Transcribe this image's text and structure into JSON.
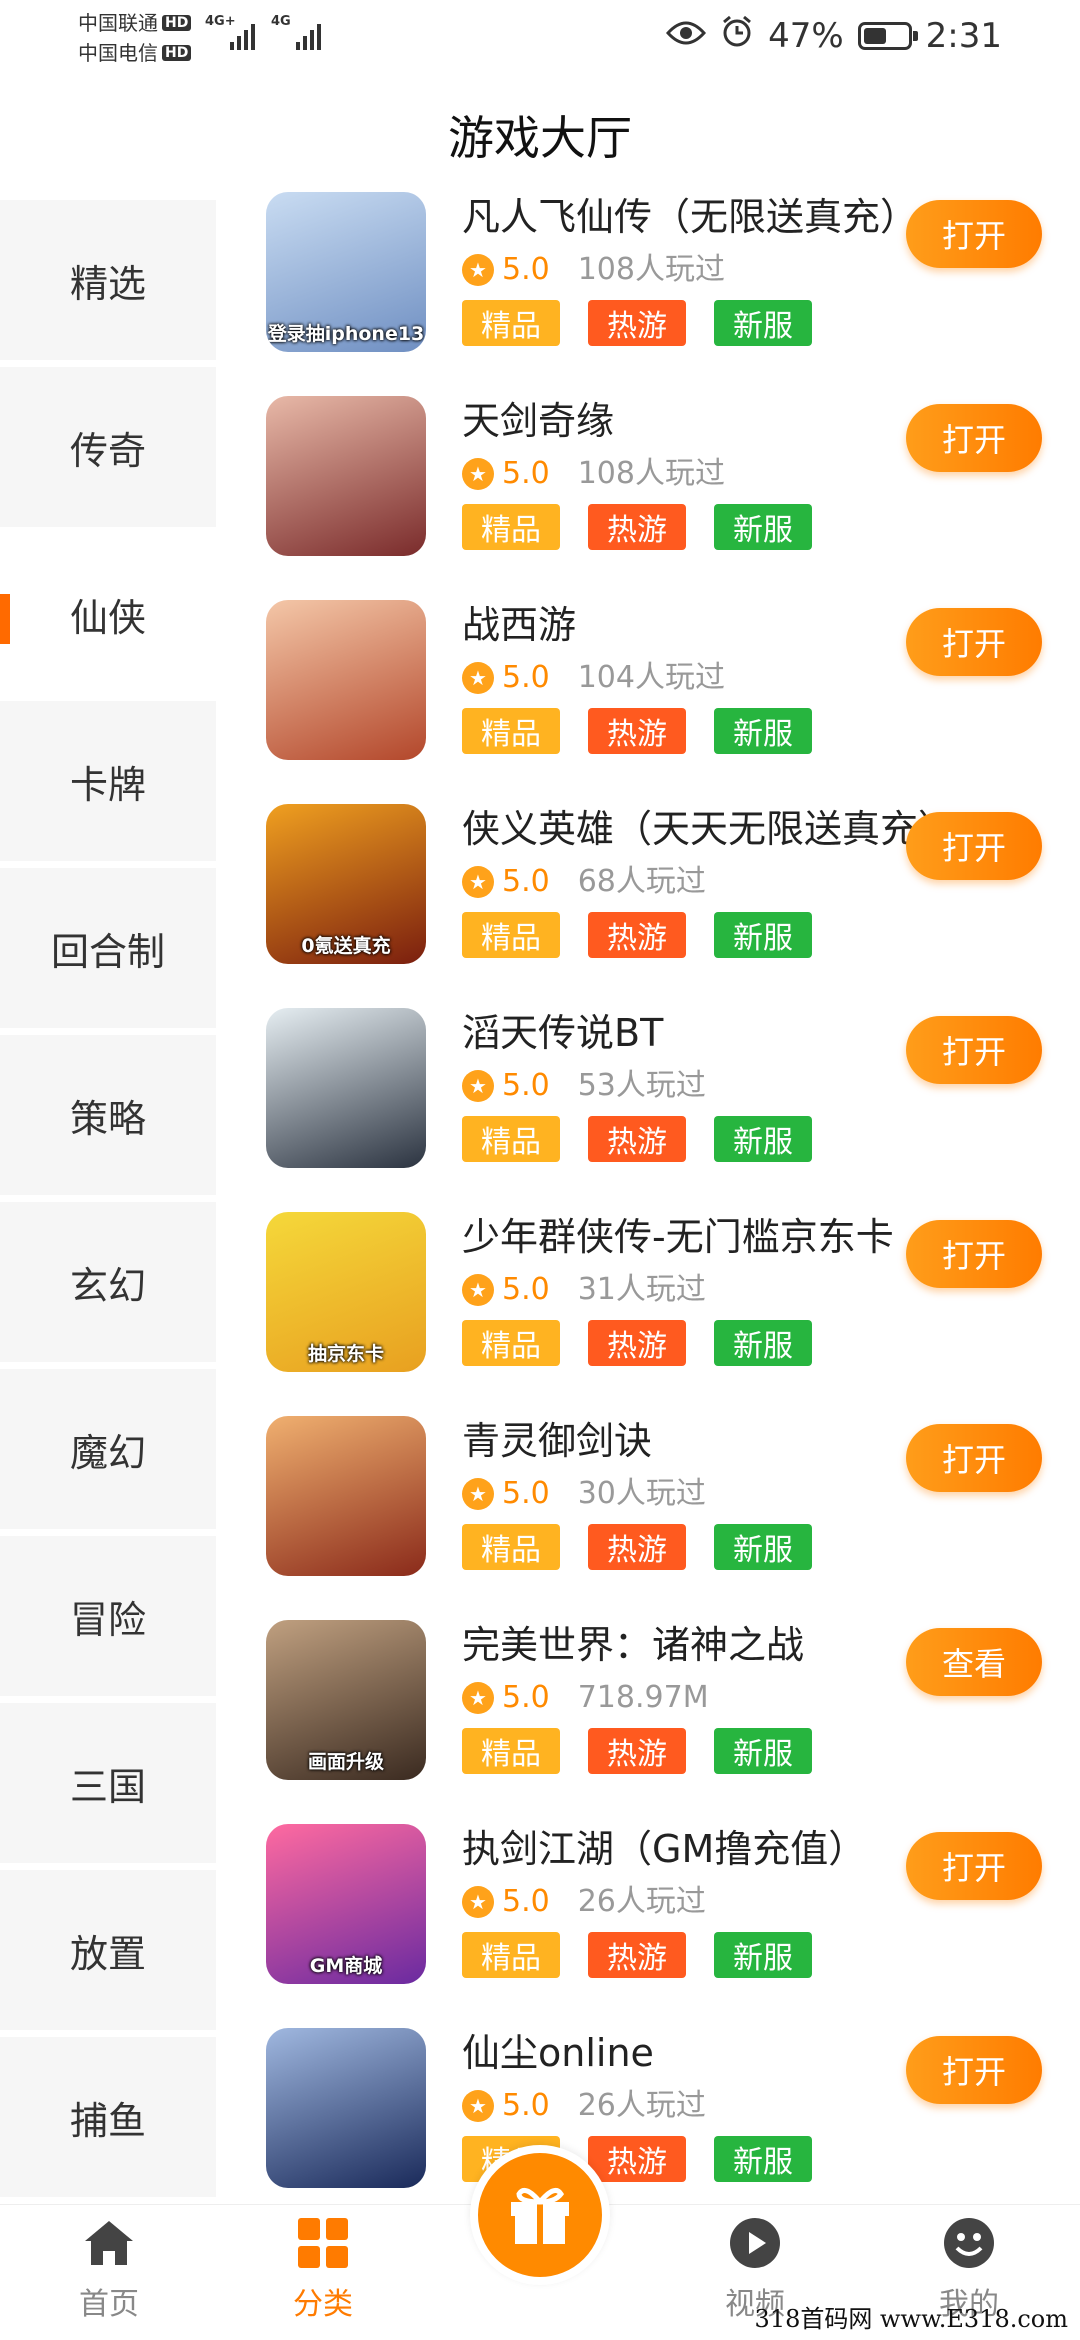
{
  "status_bar": {
    "carrier1": "中国联通",
    "carrier2": "中国电信",
    "hd": "HD",
    "net1": "4G+",
    "net2": "4G",
    "battery": "47%",
    "battery_level": 0.47,
    "time": "2:31"
  },
  "header": {
    "title": "游戏大厅"
  },
  "sidebar": {
    "items": [
      {
        "label": "精选"
      },
      {
        "label": "传奇"
      },
      {
        "label": "仙侠"
      },
      {
        "label": "卡牌"
      },
      {
        "label": "回合制"
      },
      {
        "label": "策略"
      },
      {
        "label": "玄幻"
      },
      {
        "label": "魔幻"
      },
      {
        "label": "冒险"
      },
      {
        "label": "三国"
      },
      {
        "label": "放置"
      },
      {
        "label": "捕鱼"
      }
    ],
    "active_index": 2
  },
  "tags": {
    "t1": "精品",
    "t2": "热游",
    "t3": "新服"
  },
  "games": [
    {
      "name": "凡人飞仙传（无限送真充）",
      "rating": "5.0",
      "plays": "108人玩过",
      "button": "打开",
      "icon_text": "登录抽iphone13",
      "colors": [
        "#c9dcf2",
        "#6f8fc2"
      ]
    },
    {
      "name": "天剑奇缘",
      "rating": "5.0",
      "plays": "108人玩过",
      "button": "打开",
      "icon_text": "",
      "colors": [
        "#e8b9a8",
        "#7a2b2b"
      ]
    },
    {
      "name": "战西游",
      "rating": "5.0",
      "plays": "104人玩过",
      "button": "打开",
      "icon_text": "",
      "colors": [
        "#f4c7a8",
        "#b3472b"
      ]
    },
    {
      "name": "侠义英雄（天天无限送真充）",
      "rating": "5.0",
      "plays": "68人玩过",
      "button": "打开",
      "icon_text": "0氪送真充",
      "colors": [
        "#f0a020",
        "#7a1e0e"
      ]
    },
    {
      "name": "滔天传说BT",
      "rating": "5.0",
      "plays": "53人玩过",
      "button": "打开",
      "icon_text": "",
      "colors": [
        "#e6eef2",
        "#2b3340"
      ]
    },
    {
      "name": "少年群侠传-无门槛京东卡",
      "rating": "5.0",
      "plays": "31人玩过",
      "button": "打开",
      "icon_text": "抽京东卡",
      "colors": [
        "#f5d83a",
        "#e8a020"
      ]
    },
    {
      "name": "青灵御剑诀",
      "rating": "5.0",
      "plays": "30人玩过",
      "button": "打开",
      "icon_text": "",
      "colors": [
        "#f0b070",
        "#8a2a1a"
      ]
    },
    {
      "name": "完美世界：诸神之战",
      "rating": "5.0",
      "plays": "718.97M",
      "button": "查看",
      "icon_text": "画面升级",
      "colors": [
        "#c0a080",
        "#3a2a20"
      ]
    },
    {
      "name": "执剑江湖（GM撸充值）",
      "rating": "5.0",
      "plays": "26人玩过",
      "button": "打开",
      "icon_text": "GM商城",
      "colors": [
        "#ff6aa0",
        "#6a2aa0"
      ]
    },
    {
      "name": "仙尘online",
      "rating": "5.0",
      "plays": "26人玩过",
      "button": "打开",
      "icon_text": "",
      "colors": [
        "#a0b8e0",
        "#1a2a5a"
      ]
    }
  ],
  "bottom_nav": {
    "home": "首页",
    "category": "分类",
    "video": "视频",
    "mine": "我的"
  },
  "watermark": "318首码网 www.E318.com",
  "colors": {
    "accent": "#ff7b00",
    "tag_jp": "#ffb321",
    "tag_ry": "#ff5a1f",
    "tag_xf": "#27b53f"
  }
}
